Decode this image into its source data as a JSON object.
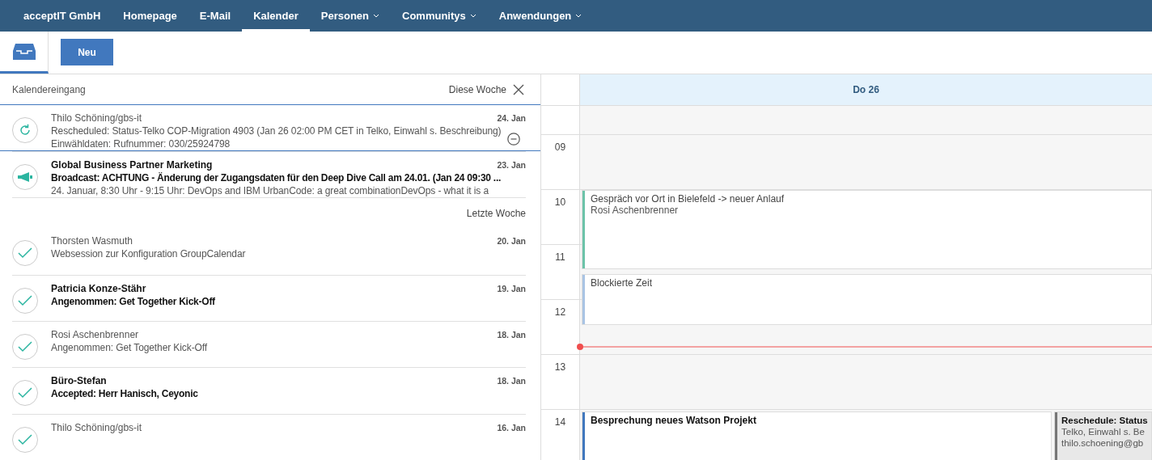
{
  "nav": {
    "items": [
      {
        "label": "acceptIT GmbH",
        "selected": false,
        "dropdown": false
      },
      {
        "label": "Homepage",
        "selected": false,
        "dropdown": false
      },
      {
        "label": "E-Mail",
        "selected": false,
        "dropdown": false
      },
      {
        "label": "Kalender",
        "selected": true,
        "dropdown": false
      },
      {
        "label": "Personen",
        "selected": false,
        "dropdown": true
      },
      {
        "label": "Communitys",
        "selected": false,
        "dropdown": true
      },
      {
        "label": "Anwendungen",
        "selected": false,
        "dropdown": true
      }
    ]
  },
  "toolbar": {
    "new_button": "Neu"
  },
  "inbox": {
    "title": "Kalendereingang",
    "filter": "Diese Woche",
    "groups": [
      {
        "items": [
          {
            "kind": "reschedule",
            "sender": "Thilo Schöning/gbs-it",
            "date": "24. Jan",
            "subject": "Rescheduled: Status-Telko COP-Migration 4903 (Jan 26 02:00 PM CET in Telko, Einwahl s. Beschreibung)",
            "preview": "Einwähldaten: Rufnummer: 030/25924798",
            "unread": false,
            "selected": true
          },
          {
            "kind": "broadcast",
            "sender": "Global Business Partner Marketing",
            "date": "23. Jan",
            "subject": "Broadcast: ACHTUNG - Änderung der Zugangsdaten für den Deep Dive Call am 24.01. (Jan 24 09:30 ...",
            "preview": "24. Januar, 8:30 Uhr - 9:15 Uhr: DevOps and IBM UrbanCode: a great combinationDevOps - what it is a",
            "unread": true,
            "selected": false
          }
        ]
      },
      {
        "label": "Letzte Woche",
        "items": [
          {
            "kind": "accepted",
            "sender": "Thorsten Wasmuth",
            "date": "20. Jan",
            "subject": "Websession zur Konfiguration GroupCalendar",
            "unread": false,
            "selected": false
          },
          {
            "kind": "accepted",
            "sender": "Patricia Konze-Stähr",
            "date": "19. Jan",
            "subject": "Angenommen: Get Together Kick-Off",
            "unread": true,
            "selected": false
          },
          {
            "kind": "accepted",
            "sender": "Rosi Aschenbrenner",
            "date": "18. Jan",
            "subject": "Angenommen: Get Together Kick-Off",
            "unread": false,
            "selected": false
          },
          {
            "kind": "accepted",
            "sender": "Büro-Stefan",
            "date": "18. Jan",
            "subject": "Accepted: Herr Hanisch, Ceyonic",
            "unread": true,
            "selected": false
          },
          {
            "kind": "accepted",
            "sender": "Thilo Schöning/gbs-it",
            "date": "16. Jan",
            "unread": false,
            "selected": false
          }
        ]
      }
    ]
  },
  "calendar": {
    "day": "Do 26",
    "hours": [
      "09",
      "10",
      "11",
      "12",
      "13",
      "14"
    ],
    "events": [
      {
        "title": "Gespräch vor Ort in Bielefeld -> neuer Anlauf",
        "lines": [
          "Rosi Aschenbrenner"
        ],
        "color": "#6cc3a9",
        "bold": false,
        "tentative": false
      },
      {
        "title": "Blockierte Zeit",
        "color": "#a9c4e4",
        "bold": false,
        "tentative": false
      },
      {
        "title": "Besprechung neues Watson Projekt",
        "color": "#4178be",
        "bold": true,
        "tentative": false
      },
      {
        "title": "Reschedule: Status",
        "lines": [
          "Telko, Einwahl s. Be",
          "thilo.schoening@gb"
        ],
        "color": "#777777",
        "bold": true,
        "tentative": true
      }
    ]
  }
}
